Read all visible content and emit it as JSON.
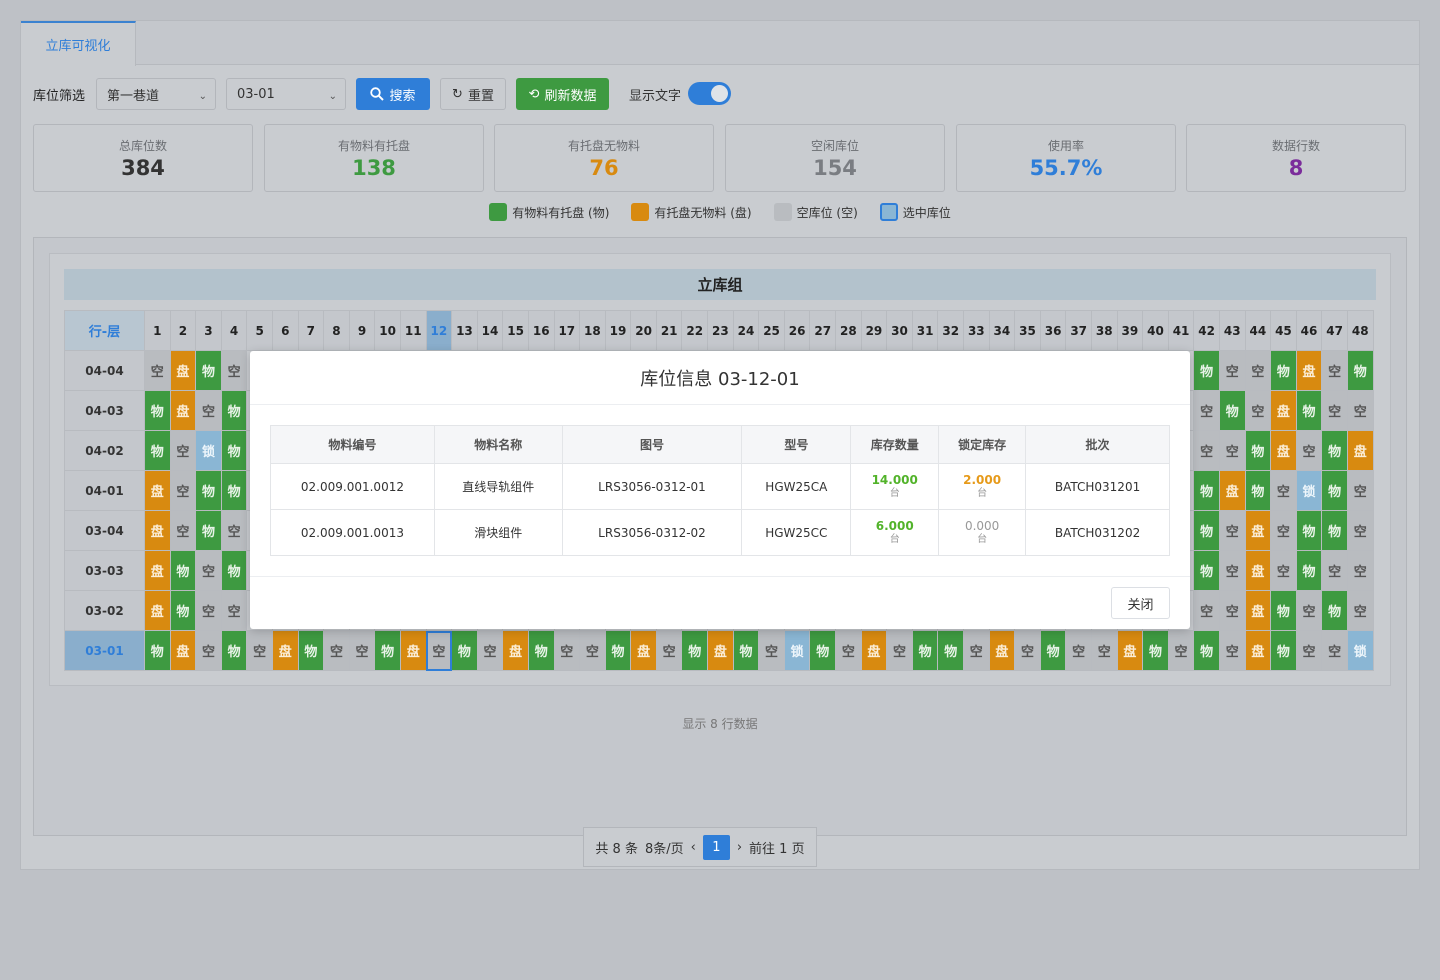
{
  "tabs": [
    {
      "label": "立库可视化"
    }
  ],
  "filter": {
    "label": "库位筛选",
    "lane": "第一巷道",
    "position": "03-01",
    "search_label": "搜索",
    "reset_label": "重置",
    "refresh_label": "刷新数据",
    "toggle_label": "显示文字",
    "toggle_on": true
  },
  "stats": [
    {
      "label": "总库位数",
      "value": "384",
      "color": "#333333"
    },
    {
      "label": "有物料有托盘",
      "value": "138",
      "color": "#3e9a41"
    },
    {
      "label": "有托盘无物料",
      "value": "76",
      "color": "#d88a10"
    },
    {
      "label": "空闲库位",
      "value": "154",
      "color": "#7a7d82"
    },
    {
      "label": "使用率",
      "value": "55.7%",
      "color": "#2f7ed8"
    },
    {
      "label": "数据行数",
      "value": "8",
      "color": "#7b2c9b"
    }
  ],
  "legend": [
    {
      "label": "有物料有托盘 (物)",
      "color": "#3e9a41"
    },
    {
      "label": "有托盘无物料 (盘)",
      "color": "#d88a10"
    },
    {
      "label": "空库位 (空)",
      "color": "#b9bcc0"
    },
    {
      "label": "选中库位",
      "color": "#8ab6d4"
    }
  ],
  "grid": {
    "group_title": "立库组",
    "corner_label": "行-层",
    "columns": [
      "1",
      "2",
      "3",
      "4",
      "5",
      "6",
      "7",
      "8",
      "9",
      "10",
      "11",
      "12",
      "13",
      "14",
      "15",
      "16",
      "17",
      "18",
      "19",
      "20",
      "21",
      "22",
      "23",
      "24",
      "25",
      "26",
      "27",
      "28",
      "29",
      "30",
      "31",
      "32",
      "33",
      "34",
      "35",
      "36",
      "37",
      "38",
      "39",
      "40",
      "41",
      "42",
      "43",
      "44",
      "45",
      "46",
      "47",
      "48"
    ],
    "selected_column": "12",
    "selected_row": "03-01",
    "rows": [
      {
        "label": "04-04",
        "cells": "kpwk.....................................wkkwpkw"
      },
      {
        "label": "04-03",
        "cells": "wpkw.....................................kwkpwkk"
      },
      {
        "label": "04-02",
        "cells": "wklw.....................................kkwpkwp"
      },
      {
        "label": "04-01",
        "cells": "pkww.....................................wpwklwk"
      },
      {
        "label": "03-04",
        "cells": "pkwk.....................................wkpkwwk"
      },
      {
        "label": "03-03",
        "cells": "pwkw.....................................wkpkwkk"
      },
      {
        "label": "03-02",
        "cells": "pwkk.....................................kkpwkwk"
      },
      {
        "label": "03-01",
        "cells": "wpkwkpwkkwpswkpwkkwpkwpwklwkpkwwkpkwkkpwkwkpwkkl"
      }
    ],
    "cell_text": {
      "w": "物",
      "p": "盘",
      "k": "空",
      "l": "锁",
      "s": "空"
    }
  },
  "footer_note": "显示 8 行数据",
  "pager": {
    "total": "共 8 条",
    "per_page": "8条/页",
    "prev": "‹",
    "current": "1",
    "next": "›",
    "goto": "前往 1 页"
  },
  "modal": {
    "title": "库位信息 03-12-01",
    "headers": [
      "物料编号",
      "物料名称",
      "图号",
      "型号",
      "库存数量",
      "锁定库存",
      "批次"
    ],
    "rows": [
      {
        "code": "02.009.001.0012",
        "name": "直线导轨组件",
        "drawing": "LRS3056-0312-01",
        "model": "HGW25CA",
        "qty": "14.000",
        "qty_unit": "台",
        "locked": "2.000",
        "locked_unit": "台",
        "batch": "BATCH031201",
        "qty_color": "#52b32a",
        "locked_color": "#e69a1a"
      },
      {
        "code": "02.009.001.0013",
        "name": "滑块组件",
        "drawing": "LRS3056-0312-02",
        "model": "HGW25CC",
        "qty": "6.000",
        "qty_unit": "台",
        "locked": "0.000",
        "locked_unit": "台",
        "batch": "BATCH031202",
        "qty_color": "#52b32a",
        "locked_color": "#999999"
      }
    ],
    "close_label": "关闭"
  }
}
